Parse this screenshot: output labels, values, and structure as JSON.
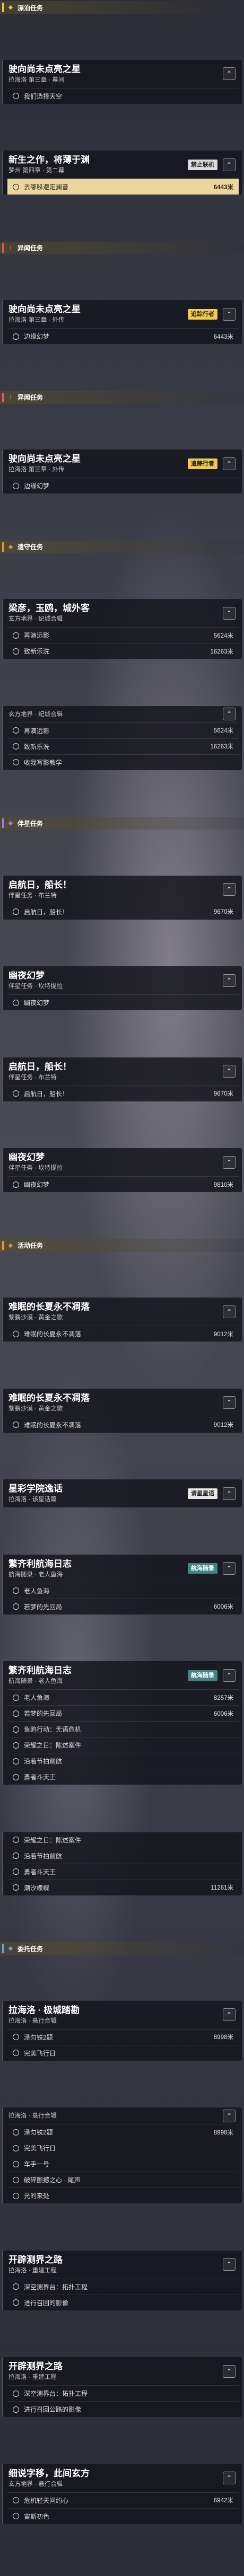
{
  "colors": {
    "cat_yellow": "#e8c04a",
    "cat_red": "#d85a5a",
    "cat_purple": "#a47be0",
    "cat_orange": "#e8922e",
    "cat_blue": "#5fa3e8",
    "highlight": "#ffe6aa"
  },
  "feed": [
    {
      "type": "category",
      "label": "漂泊任务",
      "color": "#e8c04a",
      "icon": "diamond-icon"
    },
    {
      "type": "quest",
      "title": "驶向尚未点亮之星",
      "sub": "拉海洛 第三章 · 幕间",
      "caret": "⌃",
      "objectives": [
        {
          "text": "我们选择天空",
          "dist": ""
        }
      ]
    },
    {
      "type": "quest",
      "title": "新生之作，将薄于渊",
      "sub": "梦州 第四章 · 第二幕",
      "caret": "⌃",
      "badge": "禁止联机",
      "badge_style": "gray",
      "objectives": [
        {
          "text": "去哪躲避定澜音",
          "dist": "6443米",
          "hl": true
        }
      ]
    },
    {
      "type": "category",
      "label": "异闻任务",
      "color": "#d85a5a",
      "icon": "exclaim-icon"
    },
    {
      "type": "quest",
      "title": "驶向尚未点亮之星",
      "sub": "拉海洛 第三章 · 外传",
      "caret": "⌃",
      "badge": "追踪行者",
      "badge_style": "trk",
      "objectives": [
        {
          "text": "边缘幻梦",
          "dist": "6443米"
        }
      ]
    },
    {
      "type": "category",
      "label": "异闻任务",
      "color": "#d85a5a",
      "icon": "exclaim-icon"
    },
    {
      "type": "quest",
      "title": "驶向尚未点亮之星",
      "sub": "拉海洛 第三章 · 外传",
      "caret": "⌃",
      "badge": "追踪行者",
      "badge_style": "trk",
      "objectives": [
        {
          "text": "边缘幻梦",
          "dist": ""
        }
      ]
    },
    {
      "type": "category",
      "label": "遗守任务",
      "color": "#e8922e",
      "icon": "diamond-icon"
    },
    {
      "type": "quest",
      "title": "梁彦，玉鸥，城外客",
      "sub": "玄方地界 · 纪城合辑",
      "caret": "⌃",
      "objectives": [
        {
          "text": "再演远影",
          "dist": "5624米"
        },
        {
          "text": "致新乐洗",
          "dist": "16263米"
        }
      ]
    },
    {
      "type": "quest",
      "title": "",
      "sub": "玄方地界 · 纪城合辑",
      "caret": "⌃",
      "objectives": [
        {
          "text": "再演远影",
          "dist": "5624米"
        },
        {
          "text": "致新乐洗",
          "dist": "16263米"
        },
        {
          "text": "收我写影教学",
          "dist": ""
        }
      ]
    },
    {
      "type": "category",
      "label": "伴星任务",
      "color": "#a47be0",
      "icon": "diamond-icon"
    },
    {
      "type": "quest",
      "title": "启航日，船长！",
      "sub": "伴星任务 · 布兰特",
      "caret": "⌃",
      "objectives": [
        {
          "text": "启航日，船长！",
          "dist": "9670米"
        }
      ]
    },
    {
      "type": "quest",
      "title": "幽夜幻梦",
      "sub": "伴星任务 · 坎特提拉",
      "caret": "⌃",
      "objectives": [
        {
          "text": "幽夜幻梦",
          "dist": ""
        }
      ]
    },
    {
      "type": "quest",
      "title": "启航日，船长！",
      "sub": "伴星任务 · 布兰特",
      "caret": "⌃",
      "objectives": [
        {
          "text": "启航日，船长！",
          "dist": "9670米"
        }
      ]
    },
    {
      "type": "quest",
      "title": "幽夜幻梦",
      "sub": "伴星任务 · 坎特提拉",
      "caret": "⌃",
      "objectives": [
        {
          "text": "幽夜幻梦",
          "dist": "9810米"
        }
      ]
    },
    {
      "type": "category",
      "label": "活动任务",
      "color": "#e8922e",
      "icon": "diamond-icon"
    },
    {
      "type": "quest",
      "title": "难眠的长夏永不凋落",
      "sub": "黎鹏沙漠 · 黄金之歌",
      "caret": "⌃",
      "objectives": [
        {
          "text": "难眠的长夏永不凋落",
          "dist": "9012米"
        }
      ]
    },
    {
      "type": "quest",
      "title": "难眠的长夏永不凋落",
      "sub": "黎鹏沙漠 · 黄金之歌",
      "caret": "⌃",
      "objectives": [
        {
          "text": "难眠的长夏永不凋落",
          "dist": "9012米"
        }
      ]
    },
    {
      "type": "quest",
      "title": "星彩学院逸话",
      "sub": "拉海洛 · 该星话篇",
      "caret": "⌃",
      "badge": "请星星语",
      "badge_style": "warn",
      "objectives": []
    },
    {
      "type": "quest",
      "title": "繁齐利航海日志",
      "sub": "航海随录 · 老人鱼海",
      "caret": "⌃",
      "badge": "航海随录",
      "badge_style": "teal",
      "objectives": [
        {
          "text": "老人鱼海",
          "dist": ""
        },
        {
          "text": "若梦的先回局",
          "dist": "6006米"
        }
      ]
    },
    {
      "type": "quest",
      "title": "繁齐利航海日志",
      "sub": "航海随录 · 老人鱼海",
      "caret": "⌃",
      "badge": "航海随录",
      "badge_style": "teal",
      "objectives": [
        {
          "text": "老人鱼海",
          "dist": "8257米"
        },
        {
          "text": "若梦的先回局",
          "dist": "6006米"
        },
        {
          "text": "鱼鸥行动：无语危机",
          "dist": ""
        },
        {
          "text": "荣耀之日：陈述案件",
          "dist": ""
        },
        {
          "text": "沿着节拍前航",
          "dist": ""
        },
        {
          "text": "勇者斗天王",
          "dist": ""
        }
      ]
    },
    {
      "type": "quest",
      "title": "",
      "sub": "",
      "caret": "",
      "objectives": [
        {
          "text": "荣耀之日：陈述案件",
          "dist": ""
        },
        {
          "text": "沿着节拍前航",
          "dist": ""
        },
        {
          "text": "勇者斗天王",
          "dist": ""
        },
        {
          "text": "潮汐蝶蝶",
          "dist": "11261米"
        }
      ]
    },
    {
      "type": "category",
      "label": "委托任务",
      "color": "#5fa3e8",
      "icon": "diamond-icon"
    },
    {
      "type": "quest",
      "title": "拉海洛 · 极城踏勘",
      "sub": "拉海洛 · 悬行合辑",
      "caret": "⌃",
      "objectives": [
        {
          "text": "泽匀铁2题",
          "dist": "8998米"
        },
        {
          "text": "完美飞行日",
          "dist": ""
        }
      ]
    },
    {
      "type": "quest",
      "title": "",
      "sub": "拉海洛 · 悬行合辑",
      "caret": "⌃",
      "objectives": [
        {
          "text": "泽匀铁2题",
          "dist": "8998米"
        },
        {
          "text": "完美飞行日",
          "dist": ""
        },
        {
          "text": "车手一号",
          "dist": ""
        },
        {
          "text": "破碎颤撼之心 · 尾声",
          "dist": ""
        },
        {
          "text": "光的来处",
          "dist": ""
        }
      ]
    },
    {
      "type": "quest",
      "title": "开辟测界之路",
      "sub": "拉海洛 · 重建工程",
      "caret": "⌃",
      "objectives": [
        {
          "text": "深空测界台：拓扑工程",
          "dist": ""
        },
        {
          "text": "进行召回的影像",
          "dist": ""
        }
      ]
    },
    {
      "type": "quest",
      "title": "开辟测界之路",
      "sub": "拉海洛 · 重建工程",
      "caret": "⌃",
      "objectives": [
        {
          "text": "深空测界台：拓扑工程",
          "dist": ""
        },
        {
          "text": "进行召回公路的影像",
          "dist": ""
        }
      ]
    },
    {
      "type": "quest",
      "title": "细说字移，此间玄方",
      "sub": "玄方地界 · 悬行合辑",
      "caret": "⌃",
      "objectives": [
        {
          "text": "危机轻天问约心",
          "dist": "6942米"
        },
        {
          "text": "宙斯初色",
          "dist": ""
        }
      ]
    }
  ]
}
